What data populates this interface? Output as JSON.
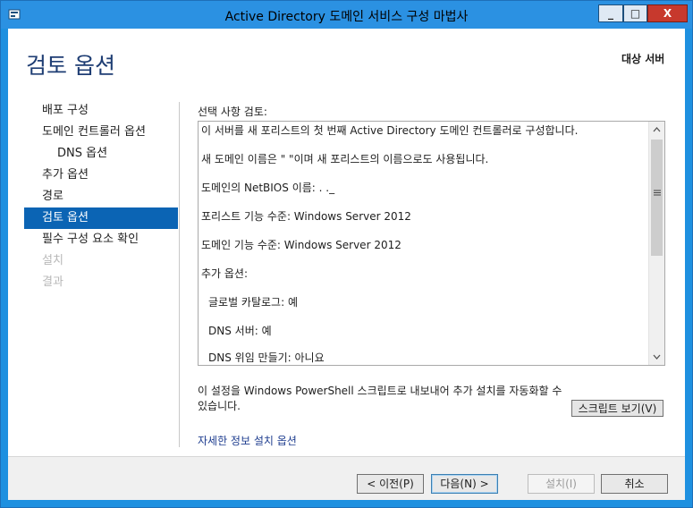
{
  "window": {
    "title": "Active Directory 도메인 서비스 구성 마법사",
    "minimize_label": "_",
    "maximize_label": "□",
    "close_label": "X"
  },
  "header": {
    "page_title": "검토 옵션",
    "target_server_label": "대상 서버"
  },
  "nav": {
    "items": [
      {
        "label": "배포 구성",
        "state": "normal"
      },
      {
        "label": "도메인 컨트롤러 옵션",
        "state": "normal"
      },
      {
        "label": "DNS 옵션",
        "state": "sub"
      },
      {
        "label": "추가 옵션",
        "state": "normal"
      },
      {
        "label": "경로",
        "state": "normal"
      },
      {
        "label": "검토 옵션",
        "state": "active"
      },
      {
        "label": "필수 구성 요소 확인",
        "state": "normal"
      },
      {
        "label": "설치",
        "state": "disabled"
      },
      {
        "label": "결과",
        "state": "disabled"
      }
    ]
  },
  "review": {
    "section_label": "선택 사항 검토:",
    "lines": [
      {
        "text": "이 서버를 새 포리스트의 첫 번째 Active Directory 도메인 컨트롤러로 구성합니다.",
        "indent": false
      },
      {
        "text": "새 도메인 이름은 \"                          \"이며 새 포리스트의 이름으로도 사용됩니다.",
        "indent": false
      },
      {
        "text": "도메인의 NetBIOS 이름: . ._",
        "indent": false
      },
      {
        "text": "포리스트 기능 수준: Windows Server 2012",
        "indent": false
      },
      {
        "text": "도메인 기능 수준: Windows Server 2012",
        "indent": false
      },
      {
        "text": "추가 옵션:",
        "indent": false
      },
      {
        "text": "글로벌 카탈로그: 예",
        "indent": true
      },
      {
        "text": "DNS 서버: 예",
        "indent": true
      },
      {
        "text": "DNS 위임 만들기: 아니요",
        "indent": true
      }
    ]
  },
  "export": {
    "text": "이 설정을 Windows PowerShell 스크립트로 내보내어 추가 설치를 자동화할 수 있습니다.",
    "view_script_button": "스크립트 보기(V)"
  },
  "more_link": "자세한 정보 설치 옵션",
  "footer": {
    "prev_button": "< 이전(P)",
    "next_button": "다음(N) >",
    "install_button": "설치(I)",
    "cancel_button": "취소"
  },
  "colors": {
    "title_bar": "#2b91e2",
    "active_nav": "#0b64b4",
    "heading": "#1e3d73",
    "close_button": "#c7392d"
  },
  "icons": {
    "app": "server-manager-icon",
    "scroll_up": "chevron-up-icon",
    "scroll_down": "chevron-down-icon",
    "scroll_grip": "grip-icon"
  }
}
